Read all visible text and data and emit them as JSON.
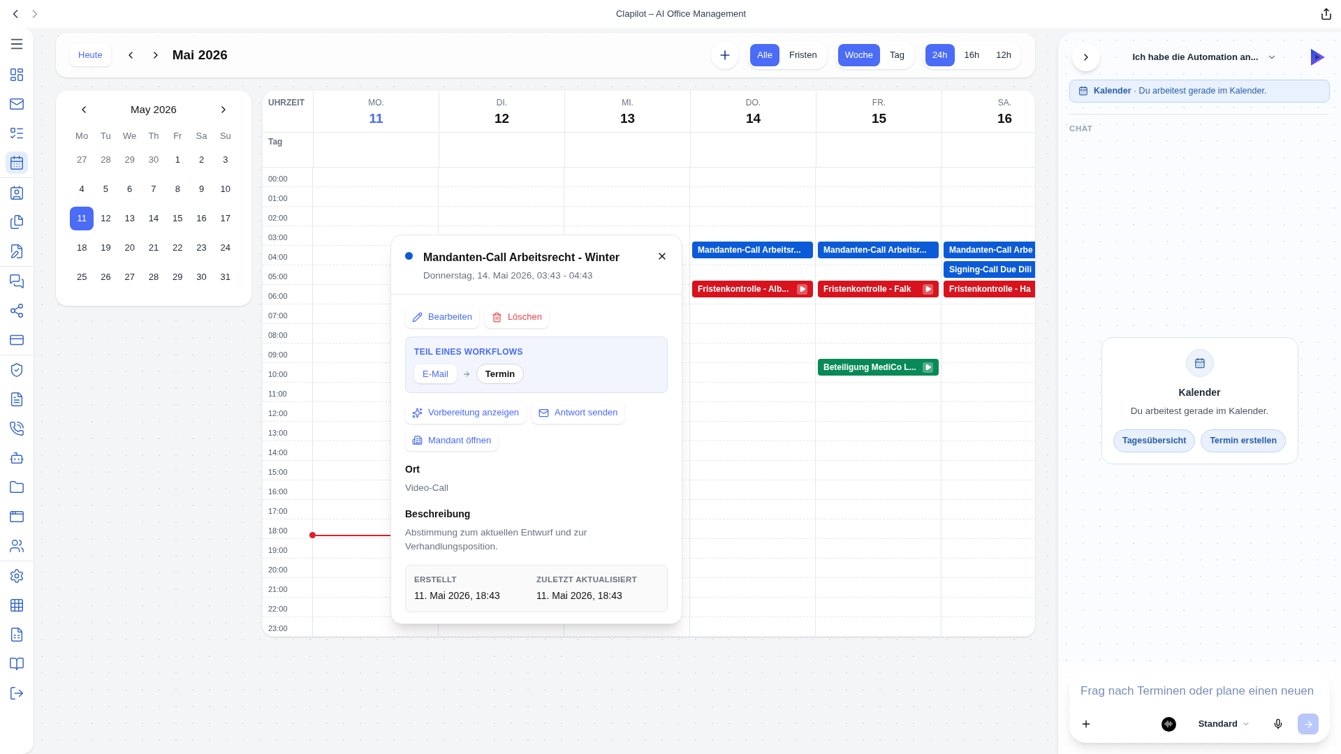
{
  "window": {
    "title": "Clapilot – AI Office Management"
  },
  "sidebar": {
    "groups": [
      [
        {
          "selected": false
        },
        {
          "selected": false
        },
        {
          "selected": false
        },
        {
          "selected": true
        }
      ],
      [
        {
          "selected": false
        },
        {
          "selected": false
        },
        {
          "selected": false
        }
      ],
      [
        {
          "selected": false
        },
        {
          "selected": false
        },
        {
          "selected": false
        }
      ],
      [
        {
          "selected": false
        },
        {
          "selected": false
        },
        {
          "selected": false
        },
        {
          "selected": false
        },
        {
          "selected": false
        },
        {
          "selected": false
        },
        {
          "selected": false
        }
      ],
      [
        {
          "selected": false
        },
        {
          "selected": false
        },
        {
          "selected": false
        },
        {
          "selected": false
        },
        {
          "selected": false
        }
      ]
    ]
  },
  "toolbar": {
    "today": "Heute",
    "period": "Mai 2026",
    "filters": [
      {
        "label": "Alle",
        "selected": true
      },
      {
        "label": "Fristen",
        "selected": false
      }
    ],
    "views": [
      {
        "label": "Woche",
        "selected": true
      },
      {
        "label": "Tag",
        "selected": false
      }
    ],
    "ranges": [
      {
        "label": "24h",
        "selected": true
      },
      {
        "label": "16h",
        "selected": false
      },
      {
        "label": "12h",
        "selected": false
      }
    ]
  },
  "mini_calendar": {
    "title": "May 2026",
    "weekdays": [
      "Mo",
      "Tu",
      "We",
      "Th",
      "Fr",
      "Sa",
      "Su"
    ],
    "weeks": [
      [
        {
          "d": "27",
          "muted": true,
          "selected": false
        },
        {
          "d": "28",
          "muted": true,
          "selected": false
        },
        {
          "d": "29",
          "muted": true,
          "selected": false
        },
        {
          "d": "30",
          "muted": true,
          "selected": false
        },
        {
          "d": "1",
          "muted": false,
          "selected": false
        },
        {
          "d": "2",
          "muted": false,
          "selected": false
        },
        {
          "d": "3",
          "muted": false,
          "selected": false
        }
      ],
      [
        {
          "d": "4",
          "muted": false,
          "selected": false
        },
        {
          "d": "5",
          "muted": false,
          "selected": false
        },
        {
          "d": "6",
          "muted": false,
          "selected": false
        },
        {
          "d": "7",
          "muted": false,
          "selected": false
        },
        {
          "d": "8",
          "muted": false,
          "selected": false
        },
        {
          "d": "9",
          "muted": false,
          "selected": false
        },
        {
          "d": "10",
          "muted": false,
          "selected": false
        }
      ],
      [
        {
          "d": "11",
          "muted": false,
          "selected": true
        },
        {
          "d": "12",
          "muted": false,
          "selected": false
        },
        {
          "d": "13",
          "muted": false,
          "selected": false
        },
        {
          "d": "14",
          "muted": false,
          "selected": false
        },
        {
          "d": "15",
          "muted": false,
          "selected": false
        },
        {
          "d": "16",
          "muted": false,
          "selected": false
        },
        {
          "d": "17",
          "muted": false,
          "selected": false
        }
      ],
      [
        {
          "d": "18",
          "muted": false,
          "selected": false
        },
        {
          "d": "19",
          "muted": false,
          "selected": false
        },
        {
          "d": "20",
          "muted": false,
          "selected": false
        },
        {
          "d": "21",
          "muted": false,
          "selected": false
        },
        {
          "d": "22",
          "muted": false,
          "selected": false
        },
        {
          "d": "23",
          "muted": false,
          "selected": false
        },
        {
          "d": "24",
          "muted": false,
          "selected": false
        }
      ],
      [
        {
          "d": "25",
          "muted": false,
          "selected": false
        },
        {
          "d": "26",
          "muted": false,
          "selected": false
        },
        {
          "d": "27",
          "muted": false,
          "selected": false
        },
        {
          "d": "28",
          "muted": false,
          "selected": false
        },
        {
          "d": "29",
          "muted": false,
          "selected": false
        },
        {
          "d": "30",
          "muted": false,
          "selected": false
        },
        {
          "d": "31",
          "muted": false,
          "selected": false
        }
      ]
    ]
  },
  "week": {
    "time_heading": "UHRZEIT",
    "allday_label": "Tag",
    "days": [
      {
        "name": "MO.",
        "date": "11",
        "selected": true
      },
      {
        "name": "DI.",
        "date": "12",
        "selected": false
      },
      {
        "name": "MI.",
        "date": "13",
        "selected": false
      },
      {
        "name": "DO.",
        "date": "14",
        "selected": false
      },
      {
        "name": "FR.",
        "date": "15",
        "selected": false
      },
      {
        "name": "SA.",
        "date": "16",
        "selected": false
      }
    ],
    "hours": [
      {
        "label": "00:00",
        "now": false
      },
      {
        "label": "01:00",
        "now": false
      },
      {
        "label": "02:00",
        "now": false
      },
      {
        "label": "03:00",
        "now": false
      },
      {
        "label": "04:00",
        "now": false,
        "cells": [
          [],
          [],
          [],
          [
            {
              "title": "Mandanten-Call Arbeitsr...",
              "color": "#0b5bd9",
              "kind": "plain"
            }
          ],
          [
            {
              "title": "Mandanten-Call Arbeitsr...",
              "color": "#0b5bd9",
              "kind": "plain"
            }
          ],
          [
            {
              "title": "Mandanten-Call Arbe",
              "color": "#0b5bd9",
              "kind": "plain"
            }
          ]
        ]
      },
      {
        "label": "05:00",
        "now": false,
        "cells": [
          [],
          [],
          [],
          [],
          [],
          [
            {
              "title": "Signing-Call Due Dili",
              "color": "#0b5bd9",
              "kind": "plain"
            }
          ]
        ]
      },
      {
        "label": "06:00",
        "now": false,
        "cells": [
          [],
          [],
          [],
          [
            {
              "title": "Fristenkontrolle - Alb...",
              "color": "#d8131d",
              "kind": "workflow"
            }
          ],
          [
            {
              "title": "Fristenkontrolle - Falk",
              "color": "#d8131d",
              "kind": "workflow"
            }
          ],
          [
            {
              "title": "Fristenkontrolle - Ha",
              "color": "#d8131d",
              "kind": "plain"
            }
          ]
        ]
      },
      {
        "label": "07:00",
        "now": false
      },
      {
        "label": "08:00",
        "now": false
      },
      {
        "label": "09:00",
        "now": false
      },
      {
        "label": "10:00",
        "now": false,
        "cells": [
          [],
          [],
          [],
          [],
          [
            {
              "title": "Beteiligung MediCo L...",
              "color": "#088a57",
              "kind": "workflow"
            }
          ],
          []
        ]
      },
      {
        "label": "11:00",
        "now": false
      },
      {
        "label": "12:00",
        "now": false
      },
      {
        "label": "13:00",
        "now": false
      },
      {
        "label": "14:00",
        "now": false
      },
      {
        "label": "15:00",
        "now": false
      },
      {
        "label": "16:00",
        "now": false
      },
      {
        "label": "17:00",
        "now": false
      },
      {
        "label": "18:00",
        "now": true
      },
      {
        "label": "19:00",
        "now": false
      },
      {
        "label": "20:00",
        "now": false
      },
      {
        "label": "21:00",
        "now": false
      },
      {
        "label": "22:00",
        "now": false
      },
      {
        "label": "23:00",
        "now": false
      }
    ]
  },
  "event_popup": {
    "title": "Mandanten-Call Arbeitsrecht - Winter",
    "subtitle": "Donnerstag, 14. Mai 2026, 03:43 - 04:43",
    "actions": [
      {
        "kind": "edit",
        "label": "Bearbeiten"
      },
      {
        "kind": "delete",
        "label": "Löschen"
      }
    ],
    "workflow": {
      "heading": "TEIL EINES WORKFLOWS",
      "steps": [
        {
          "label": "E-Mail",
          "selected": false
        },
        {
          "label": "Termin",
          "selected": true
        }
      ]
    },
    "links": [
      {
        "kind": "prepare",
        "label": "Vorbereitung anzeigen"
      },
      {
        "kind": "reply",
        "label": "Antwort senden"
      },
      {
        "kind": "client",
        "label": "Mandant öffnen"
      }
    ],
    "sections": [
      {
        "heading": "Ort",
        "text": "Video-Call"
      },
      {
        "heading": "Beschreibung",
        "text": "Abstimmung zum aktuellen Entwurf und zur Verhandlungsposition."
      }
    ],
    "meta": [
      {
        "label": "ERSTELLT",
        "value": "11. Mai 2026, 18:43"
      },
      {
        "label": "ZULETZT AKTUALISIERT",
        "value": "11. Mai 2026, 18:43"
      }
    ]
  },
  "assistant": {
    "conversation": "Ich habe die Automation an...",
    "context": "**Kalender** · Du arbeitest gerade im Kalender.",
    "chat_label": "CHAT",
    "card": {
      "title": "Kalender",
      "text": "Du arbeitest gerade im Kalender.",
      "buttons": [
        "Tagesübersicht",
        "Termin erstellen"
      ]
    },
    "input": {
      "placeholder": "Frag nach Terminen oder plane einen neuen",
      "mode": "Standard"
    }
  }
}
